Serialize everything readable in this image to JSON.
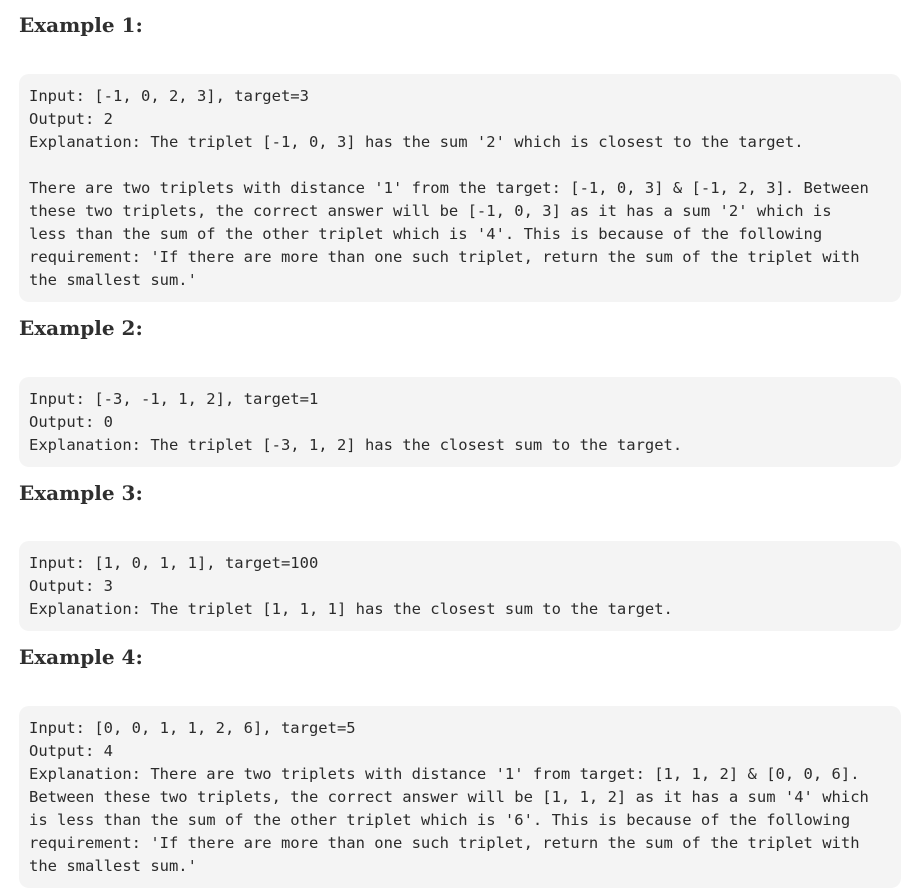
{
  "examples": [
    {
      "heading": "Example 1:",
      "lines": [
        "Input: [-1, 0, 2, 3], target=3",
        "Output: 2",
        "Explanation: The triplet [-1, 0, 3] has the sum '2' which is closest to the target.",
        "",
        "There are two triplets with distance '1' from the target: [-1, 0, 3] & [-1, 2, 3]. Between",
        "these two triplets, the correct answer will be [-1, 0, 3] as it has a sum '2' which is",
        "less than the sum of the other triplet which is '4'. This is because of the following",
        "requirement: 'If there are more than one such triplet, return the sum of the triplet with",
        "the smallest sum.'"
      ]
    },
    {
      "heading": "Example 2:",
      "lines": [
        "Input: [-3, -1, 1, 2], target=1",
        "Output: 0",
        "Explanation: The triplet [-3, 1, 2] has the closest sum to the target."
      ]
    },
    {
      "heading": "Example 3:",
      "lines": [
        "Input: [1, 0, 1, 1], target=100",
        "Output: 3",
        "Explanation: The triplet [1, 1, 1] has the closest sum to the target."
      ]
    },
    {
      "heading": "Example 4:",
      "lines": [
        "Input: [0, 0, 1, 1, 2, 6], target=5",
        "Output: 4",
        "Explanation: There are two triplets with distance '1' from target: [1, 1, 2] & [0, 0, 6].",
        "Between these two triplets, the correct answer will be [1, 1, 2] as it has a sum '4' which",
        "is less than the sum of the other triplet which is '6'. This is because of the following",
        "requirement: 'If there are more than one such triplet, return the sum of the triplet with",
        "the smallest sum.'"
      ]
    }
  ]
}
